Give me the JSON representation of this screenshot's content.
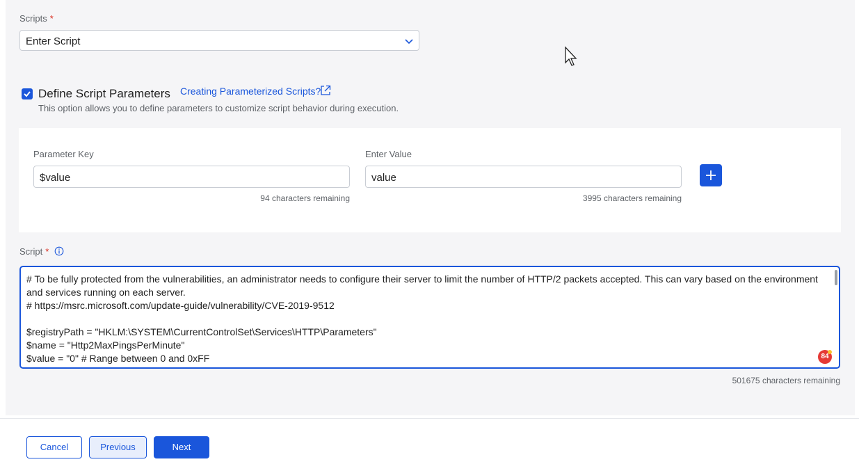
{
  "scripts": {
    "label": "Scripts",
    "required_mark": "*",
    "selected": "Enter Script"
  },
  "params_toggle": {
    "checked": true,
    "label": "Define Script Parameters",
    "link_text": "Creating Parameterized Scripts?",
    "help_text": "This option allows you to define parameters to customize script behavior during execution."
  },
  "parameters": {
    "key_label": "Parameter Key",
    "key_value": "$value",
    "key_remaining": "94 characters remaining",
    "value_label": "Enter Value",
    "value_value": "value",
    "value_remaining": "3995 characters remaining"
  },
  "script": {
    "label": "Script",
    "required_mark": "*",
    "content": "# To be fully protected from the vulnerabilities, an administrator needs to configure their server to limit the number of HTTP/2 packets accepted. This can vary based on the environment and services running on each server.\n# https://msrc.microsoft.com/update-guide/vulnerability/CVE-2019-9512\n\n$registryPath = \"HKLM:\\SYSTEM\\CurrentControlSet\\Services\\HTTP\\Parameters\"\n$name = \"Http2MaxPingsPerMinute\"\n$value = \"0\" # Range between 0 and 0xFF",
    "remaining": "501675 characters remaining",
    "grammar_count": "84"
  },
  "footer": {
    "cancel": "Cancel",
    "previous": "Previous",
    "next": "Next"
  },
  "colors": {
    "accent": "#1a56db",
    "required": "#d92d20",
    "panel_bg": "#f5f5f7"
  }
}
